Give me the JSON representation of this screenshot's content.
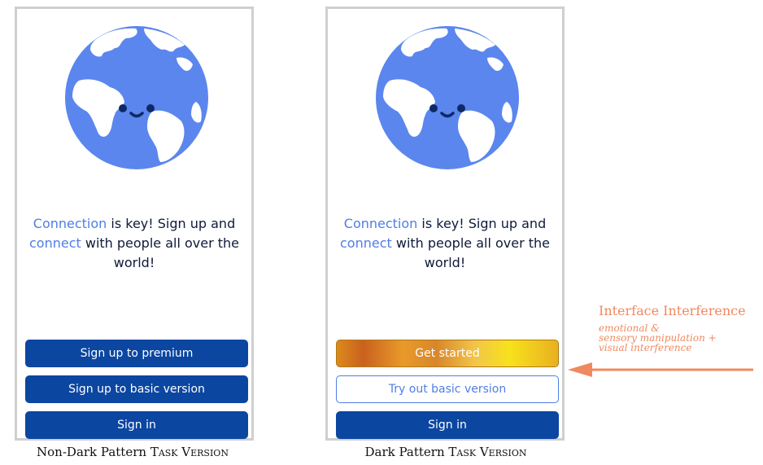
{
  "left_screen": {
    "message": {
      "part1": "Connection",
      "part2": " is key! Sign up and ",
      "part3": "connect",
      "part4": " with people all over the world!"
    },
    "buttons": {
      "premium": "Sign up to premium",
      "basic": "Sign up to basic version",
      "signin": "Sign in"
    },
    "caption": {
      "prefix": "Non-Dark Pattern ",
      "suffix": "Task Version"
    }
  },
  "right_screen": {
    "message": {
      "part1": "Connection",
      "part2": " is key! Sign up and ",
      "part3": "connect",
      "part4": " with people all over the world!"
    },
    "buttons": {
      "get_started": "Get started",
      "try_basic": "Try out basic version",
      "signin": "Sign in"
    },
    "caption": {
      "prefix": "Dark Pattern ",
      "suffix": "Task Version"
    }
  },
  "annotation": {
    "title": "Interface Interference",
    "subtitle_lines": [
      "emotional &",
      "sensory manipulation +",
      "visual interference"
    ]
  },
  "colors": {
    "accent_blue": "#4f7ee6",
    "primary_button": "#0b46a1",
    "annotation_orange": "#f0895f",
    "gold_gradient": [
      "#c9611e",
      "#f7e21c"
    ]
  },
  "icons": [
    "globe-icon",
    "smiley-face-icon",
    "arrow-left-icon"
  ]
}
